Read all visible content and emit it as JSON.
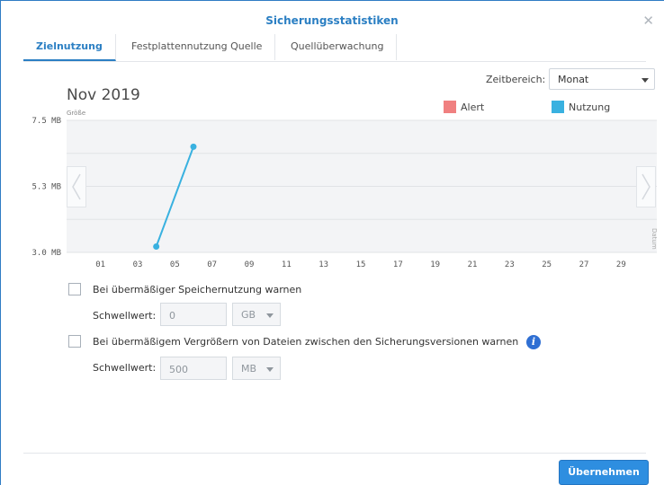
{
  "window": {
    "title": "Sicherungsstatistiken",
    "close_icon": "close-icon"
  },
  "tabs": [
    {
      "label": "Zielnutzung",
      "active": true
    },
    {
      "label": "Festplattennutzung Quelle",
      "active": false
    },
    {
      "label": "Quellüberwachung",
      "active": false
    }
  ],
  "time_range": {
    "label": "Zeitbereich:",
    "value": "Monat"
  },
  "period": "Nov 2019",
  "legend": [
    {
      "label": "Alert",
      "color": "#f08080"
    },
    {
      "label": "Nutzung",
      "color": "#39b1e0"
    }
  ],
  "chart_data": {
    "type": "line",
    "ylabel": "Größe",
    "xlabel": "Datum",
    "yticks": [
      "7.5 MB",
      "5.3 MB",
      "3.0 MB"
    ],
    "ylim": [
      3.0,
      7.5
    ],
    "x_ticks": [
      "01",
      "03",
      "05",
      "07",
      "09",
      "11",
      "13",
      "15",
      "17",
      "19",
      "21",
      "23",
      "25",
      "27",
      "29"
    ],
    "xlim": [
      0,
      30
    ],
    "series": [
      {
        "name": "Nutzung",
        "color": "#39b1e0",
        "points": [
          {
            "x": 4,
            "y": 3.2
          },
          {
            "x": 6,
            "y": 6.6
          }
        ]
      }
    ],
    "grid": true
  },
  "options": {
    "storage_warning": {
      "label": "Bei übermäßiger Speichernutzung warnen",
      "checked": false,
      "threshold_label": "Schwellwert:",
      "threshold_value": "0",
      "unit": "GB"
    },
    "file_growth_warning": {
      "label": "Bei übermäßigem Vergrößern von Dateien zwischen den Sicherungsversionen warnen",
      "checked": false,
      "threshold_label": "Schwellwert:",
      "threshold_value": "500",
      "unit": "MB"
    }
  },
  "footer": {
    "apply_label": "Übernehmen"
  }
}
